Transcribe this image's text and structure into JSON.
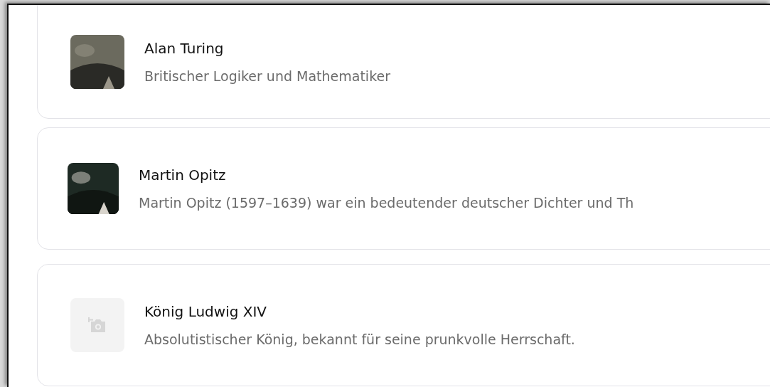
{
  "people": [
    {
      "name": "Alan Turing",
      "description": "Britischer Logiker und Mathematiker"
    },
    {
      "name": "Martin Opitz",
      "description": "Martin Opitz (1597–1639) war ein bedeutender deutscher Dichter und Th"
    },
    {
      "name": "König Ludwig XIV",
      "description": "Absolutistischer König, bekannt für seine prunkvolle Herrschaft.",
      "image": {
        "kind": "placeholder"
      }
    }
  ]
}
